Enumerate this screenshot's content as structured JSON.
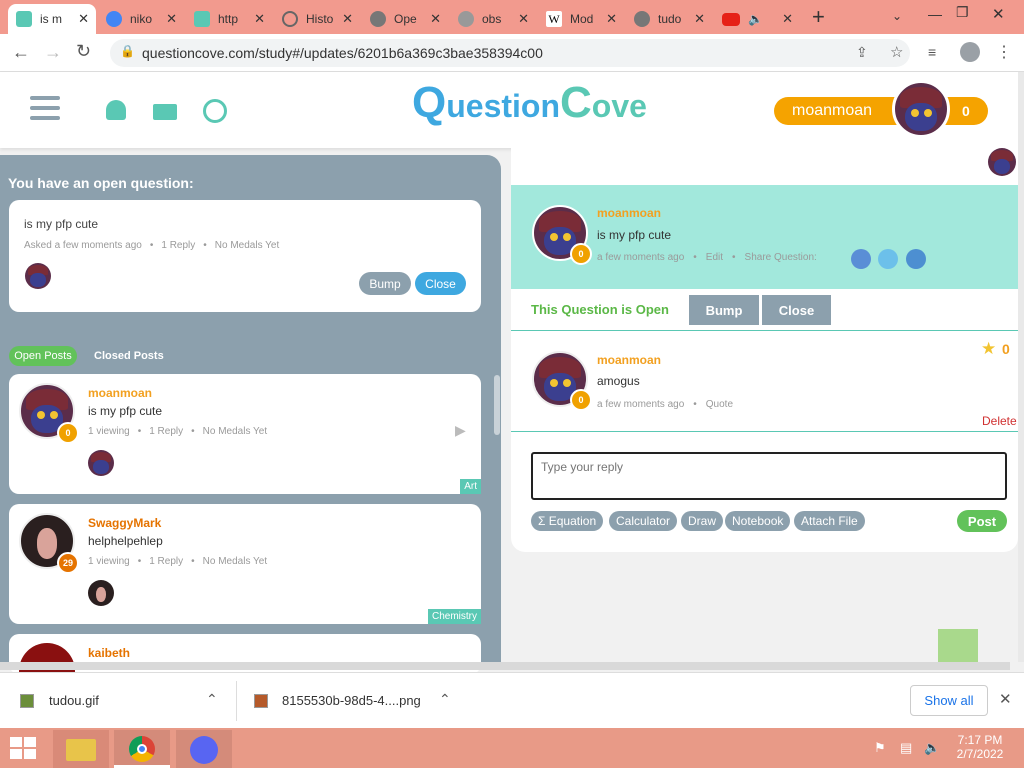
{
  "tabs": [
    {
      "label": "is m",
      "color": "#5ac8b4"
    },
    {
      "label": "niko",
      "color": "#4285f4"
    },
    {
      "label": "http",
      "color": "#5ac8b4"
    },
    {
      "label": "Histo",
      "color": "#666666"
    },
    {
      "label": "Ope",
      "color": "#666666"
    },
    {
      "label": "obs",
      "color": "#888888"
    },
    {
      "label": "Mod",
      "color": "#222222"
    },
    {
      "label": "tudo",
      "color": "#666666"
    }
  ],
  "browser": {
    "url": "questioncove.com/study#/updates/6201b6a369c3bae358394c00",
    "wiki_letter": "W"
  },
  "site": {
    "logo_q": "Q",
    "logo_rest": "uestion",
    "logo_c": "C",
    "logo_ove": "ove",
    "username": "moanmoan",
    "points": "0"
  },
  "open_question": {
    "heading": "You have an open question:",
    "text": "is my pfp cute",
    "asked": "Asked a few moments ago",
    "replies": "1 Reply",
    "medals": "No Medals Yet",
    "bump": "Bump",
    "close": "Close"
  },
  "post_tabs": {
    "open": "Open Posts",
    "closed": "Closed Posts"
  },
  "posts": [
    {
      "user": "moanmoan",
      "text": "is my pfp cute",
      "viewing": "1 viewing",
      "replies": "1 Reply",
      "medals": "No Medals Yet",
      "badge": "0",
      "tag": "Art"
    },
    {
      "user": "SwaggyMark",
      "text": "helphelpehlep",
      "viewing": "1 viewing",
      "replies": "1 Reply",
      "medals": "No Medals Yet",
      "badge": "29",
      "tag": "Chemistry"
    },
    {
      "user": "kaibeth"
    }
  ],
  "question": {
    "user": "moanmoan",
    "text": "is my pfp cute",
    "time": "a few moments ago",
    "edit": "Edit",
    "share": "Share Question:",
    "badge": "0",
    "status": "This Question is Open",
    "bump": "Bump",
    "close": "Close"
  },
  "reply": {
    "user": "moanmoan",
    "text": "amogus",
    "time": "a few moments ago",
    "quote": "Quote",
    "badge": "0",
    "medals": "0",
    "delete": "Delete"
  },
  "composer": {
    "placeholder": "Type your reply",
    "tools": [
      "Σ Equation",
      "Calculator",
      "Draw",
      "Notebook",
      "Attach File"
    ],
    "post": "Post"
  },
  "downloads": {
    "items": [
      "tudou.gif",
      "8155530b-98d5-4....png"
    ],
    "show_all": "Show all"
  },
  "taskbar": {
    "time": "7:17 PM",
    "date": "2/7/2022"
  }
}
